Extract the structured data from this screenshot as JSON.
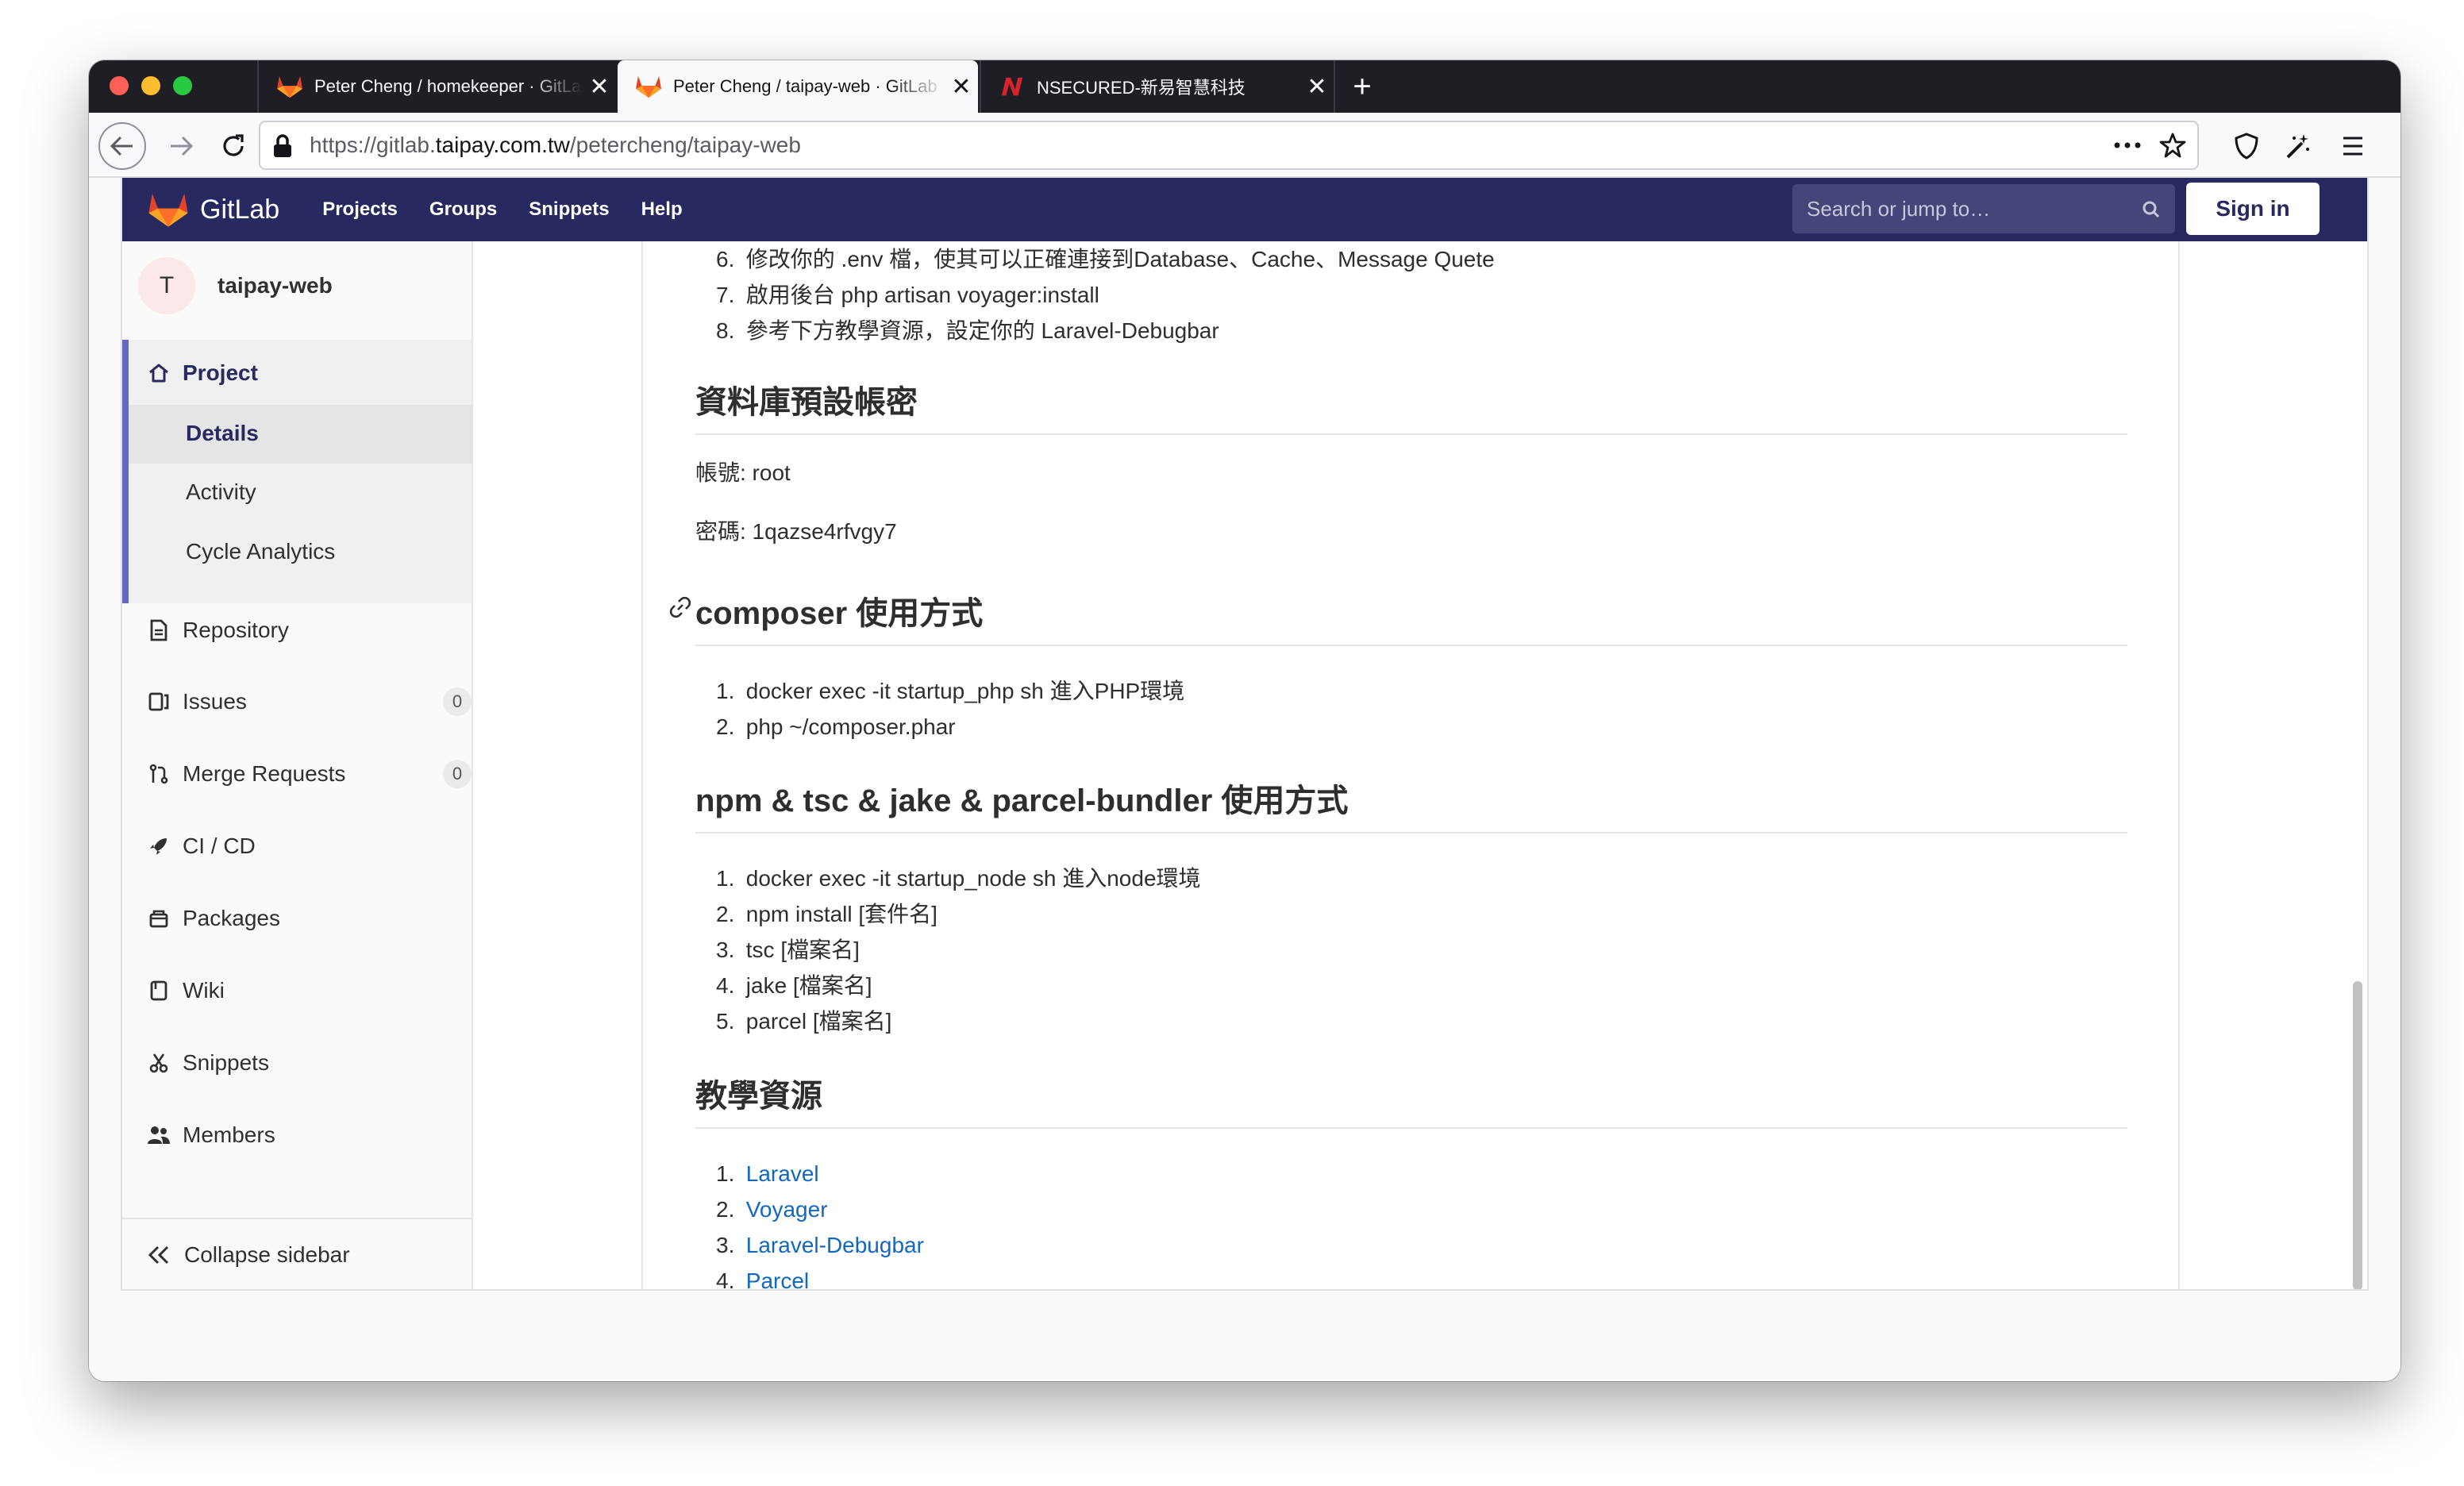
{
  "browser": {
    "tabs": [
      {
        "title": "Peter Cheng / homekeeper · GitLab",
        "active": false
      },
      {
        "title": "Peter Cheng / taipay-web · GitLab",
        "active": true
      },
      {
        "title": "NSECURED-新易智慧科技",
        "active": false
      }
    ],
    "new_tab_label": "+",
    "close_label": "✕",
    "url_prefix": "https://gitlab.",
    "url_host": "taipay.com.tw",
    "url_path": "/petercheng/taipay-web"
  },
  "gitlab": {
    "logo_text": "GitLab",
    "nav": [
      "Projects",
      "Groups",
      "Snippets",
      "Help"
    ],
    "search_placeholder": "Search or jump to…",
    "sign_in": "Sign in",
    "accent": "#292961"
  },
  "sidebar": {
    "project_initial": "T",
    "project_name": "taipay-web",
    "project_label": "Project",
    "sub_items": [
      "Details",
      "Activity",
      "Cycle Analytics"
    ],
    "items": [
      {
        "label": "Repository",
        "icon": "document-icon"
      },
      {
        "label": "Issues",
        "icon": "issues-icon",
        "count": "0"
      },
      {
        "label": "Merge Requests",
        "icon": "merge-request-icon",
        "count": "0"
      },
      {
        "label": "CI / CD",
        "icon": "rocket-icon"
      },
      {
        "label": "Packages",
        "icon": "package-icon"
      },
      {
        "label": "Wiki",
        "icon": "book-icon"
      },
      {
        "label": "Snippets",
        "icon": "scissors-icon"
      },
      {
        "label": "Members",
        "icon": "users-icon"
      }
    ],
    "collapse_label": "Collapse sidebar"
  },
  "content": {
    "setup_steps": [
      {
        "n": "6.",
        "text": "修改你的 .env 檔，使其可以正確連接到Database、Cache、Message Quete"
      },
      {
        "n": "7.",
        "text": "啟用後台 php artisan voyager:install"
      },
      {
        "n": "8.",
        "text": "參考下方教學資源，設定你的 Laravel-Debugbar"
      }
    ],
    "db_heading": "資料庫預設帳密",
    "db_account": "帳號: root",
    "db_password": "密碼: 1qazse4rfvgy7",
    "composer_heading": "composer 使用方式",
    "composer_steps": [
      {
        "n": "1.",
        "text": "docker exec -it startup_php sh 進入PHP環境"
      },
      {
        "n": "2.",
        "text": "php ~/composer.phar"
      }
    ],
    "npm_heading": "npm & tsc & jake & parcel-bundler 使用方式",
    "npm_steps": [
      {
        "n": "1.",
        "text": "docker exec -it startup_node sh 進入node環境"
      },
      {
        "n": "2.",
        "text": "npm install [套件名]"
      },
      {
        "n": "3.",
        "text": "tsc [檔案名]"
      },
      {
        "n": "4.",
        "text": "jake [檔案名]"
      },
      {
        "n": "5.",
        "text": "parcel [檔案名]"
      }
    ],
    "resources_heading": "教學資源",
    "resources": [
      {
        "n": "1.",
        "text": "Laravel"
      },
      {
        "n": "2.",
        "text": "Voyager"
      },
      {
        "n": "3.",
        "text": "Laravel-Debugbar"
      },
      {
        "n": "4.",
        "text": "Parcel"
      }
    ],
    "link_color": "#1068bf"
  }
}
